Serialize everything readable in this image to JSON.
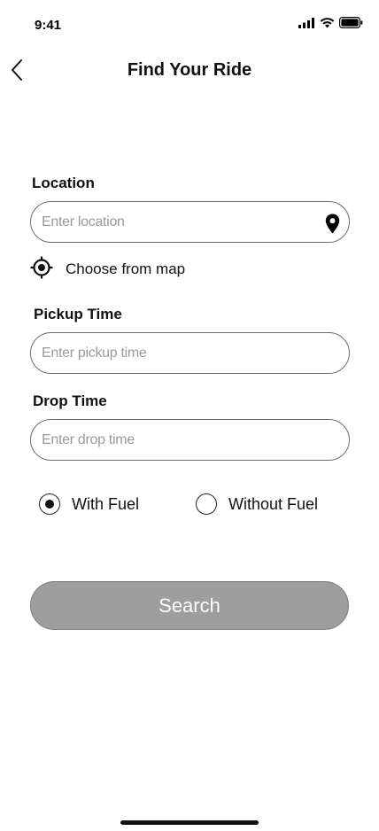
{
  "status_bar": {
    "time": "9:41",
    "icons": [
      "signal-icon",
      "wifi-icon",
      "battery-icon"
    ]
  },
  "header": {
    "title": "Find Your Ride",
    "back_icon": "chevron-left-icon"
  },
  "form": {
    "location": {
      "label": "Location",
      "placeholder": "Enter location",
      "value": "",
      "icon": "map-pin-icon"
    },
    "map_choice": {
      "label": "Choose from map",
      "icon": "crosshair-target-icon"
    },
    "pickup": {
      "label": "Pickup Time",
      "placeholder": "Enter pickup time",
      "value": ""
    },
    "drop": {
      "label": "Drop Time",
      "placeholder": "Enter drop time",
      "value": ""
    },
    "fuel_options": [
      {
        "label": "With Fuel",
        "selected": true
      },
      {
        "label": "Without Fuel",
        "selected": false
      }
    ],
    "search_label": "Search"
  },
  "colors": {
    "button_bg": "#9e9e9e",
    "border": "#6e6e6e",
    "placeholder": "#9a9a9a"
  }
}
